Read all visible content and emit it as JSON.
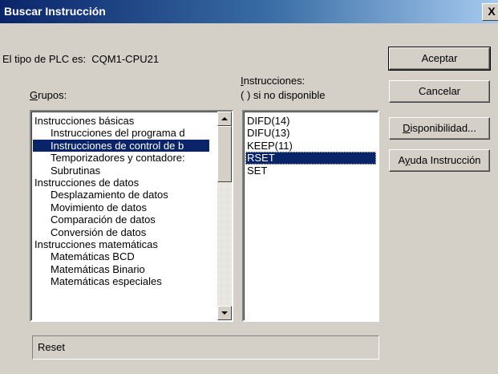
{
  "window": {
    "title": "Buscar Instrucción",
    "close_label": "X"
  },
  "plc": {
    "label": "El tipo de PLC es:",
    "value": "CQM1-CPU21"
  },
  "groups": {
    "label_accel": "G",
    "label_rest": "rupos:",
    "items": [
      {
        "label": "Instrucciones básicas",
        "level": 0,
        "selected": false
      },
      {
        "label": "Instrucciones del programa d",
        "level": 1,
        "selected": false
      },
      {
        "label": "Instrucciones de control de b",
        "level": 1,
        "selected": true
      },
      {
        "label": "Temporizadores y contadore:",
        "level": 1,
        "selected": false
      },
      {
        "label": "Subrutinas",
        "level": 1,
        "selected": false
      },
      {
        "label": "Instrucciones de datos",
        "level": 0,
        "selected": false
      },
      {
        "label": "Desplazamiento de datos",
        "level": 1,
        "selected": false
      },
      {
        "label": "Movimiento de datos",
        "level": 1,
        "selected": false
      },
      {
        "label": "Comparación de datos",
        "level": 1,
        "selected": false
      },
      {
        "label": "Conversión de datos",
        "level": 1,
        "selected": false
      },
      {
        "label": "Instrucciones matemáticas",
        "level": 0,
        "selected": false
      },
      {
        "label": "Matemáticas BCD",
        "level": 1,
        "selected": false
      },
      {
        "label": "Matemáticas Binario",
        "level": 1,
        "selected": false
      },
      {
        "label": "Matemáticas especiales",
        "level": 1,
        "selected": false
      }
    ]
  },
  "instructions": {
    "label_accel": "I",
    "label_rest": "nstrucciones:",
    "note": "( ) si no disponible",
    "items": [
      {
        "label": "DIFD(14)",
        "selected": false
      },
      {
        "label": "DIFU(13)",
        "selected": false
      },
      {
        "label": "KEEP(11)",
        "selected": false
      },
      {
        "label": "RSET",
        "selected": true
      },
      {
        "label": "SET",
        "selected": false
      }
    ]
  },
  "buttons": {
    "accept": "Aceptar",
    "cancel": "Cancelar",
    "availability_accel": "D",
    "availability_rest": "isponibilidad...",
    "help_pre": "A",
    "help_accel": "y",
    "help_rest": "uda Instrucción"
  },
  "status_text": "Reset"
}
